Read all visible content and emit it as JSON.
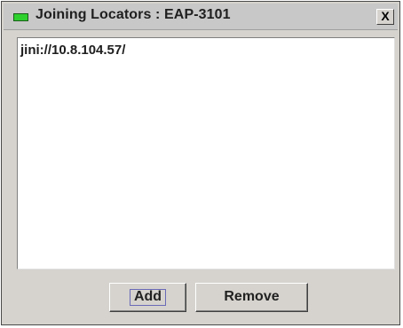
{
  "window": {
    "title": "Joining Locators : EAP-3101",
    "close_glyph": "X"
  },
  "locators": {
    "items": [
      "jini://10.8.104.57/"
    ]
  },
  "buttons": {
    "add_label": "Add",
    "remove_label": "Remove"
  },
  "colors": {
    "title_icon": "#2fd12f",
    "window_bg": "#d6d3ce",
    "list_bg": "#ffffff"
  },
  "icons": {
    "title": "window-icon",
    "close": "close-icon"
  }
}
